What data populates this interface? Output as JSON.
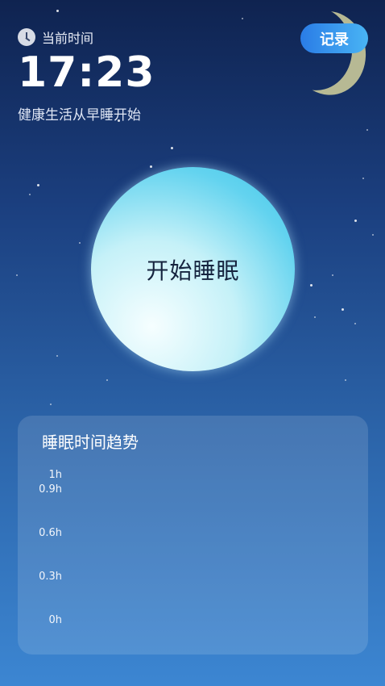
{
  "header": {
    "clock_label": "当前时间",
    "time": "17:23",
    "slogan": "健康生活从早睡开始"
  },
  "toolbar": {
    "record_label": "记录"
  },
  "main": {
    "sleep_button_label": "开始睡眠"
  },
  "chart_panel": {
    "title": "睡眠时间趋势",
    "y_ticks": [
      "1h",
      "0.9h",
      "0.6h",
      "0.3h",
      "0h"
    ]
  },
  "chart_data": {
    "type": "bar",
    "title": "睡眠时间趋势",
    "categories": [],
    "values": [],
    "ylim": [
      0,
      1
    ],
    "y_tick_labels": [
      "0h",
      "0.3h",
      "0.6h",
      "0.9h",
      "1h"
    ],
    "grid": false
  },
  "colors": {
    "record_button": "#2a7ce6",
    "sleep_button": "#63d3ef"
  }
}
